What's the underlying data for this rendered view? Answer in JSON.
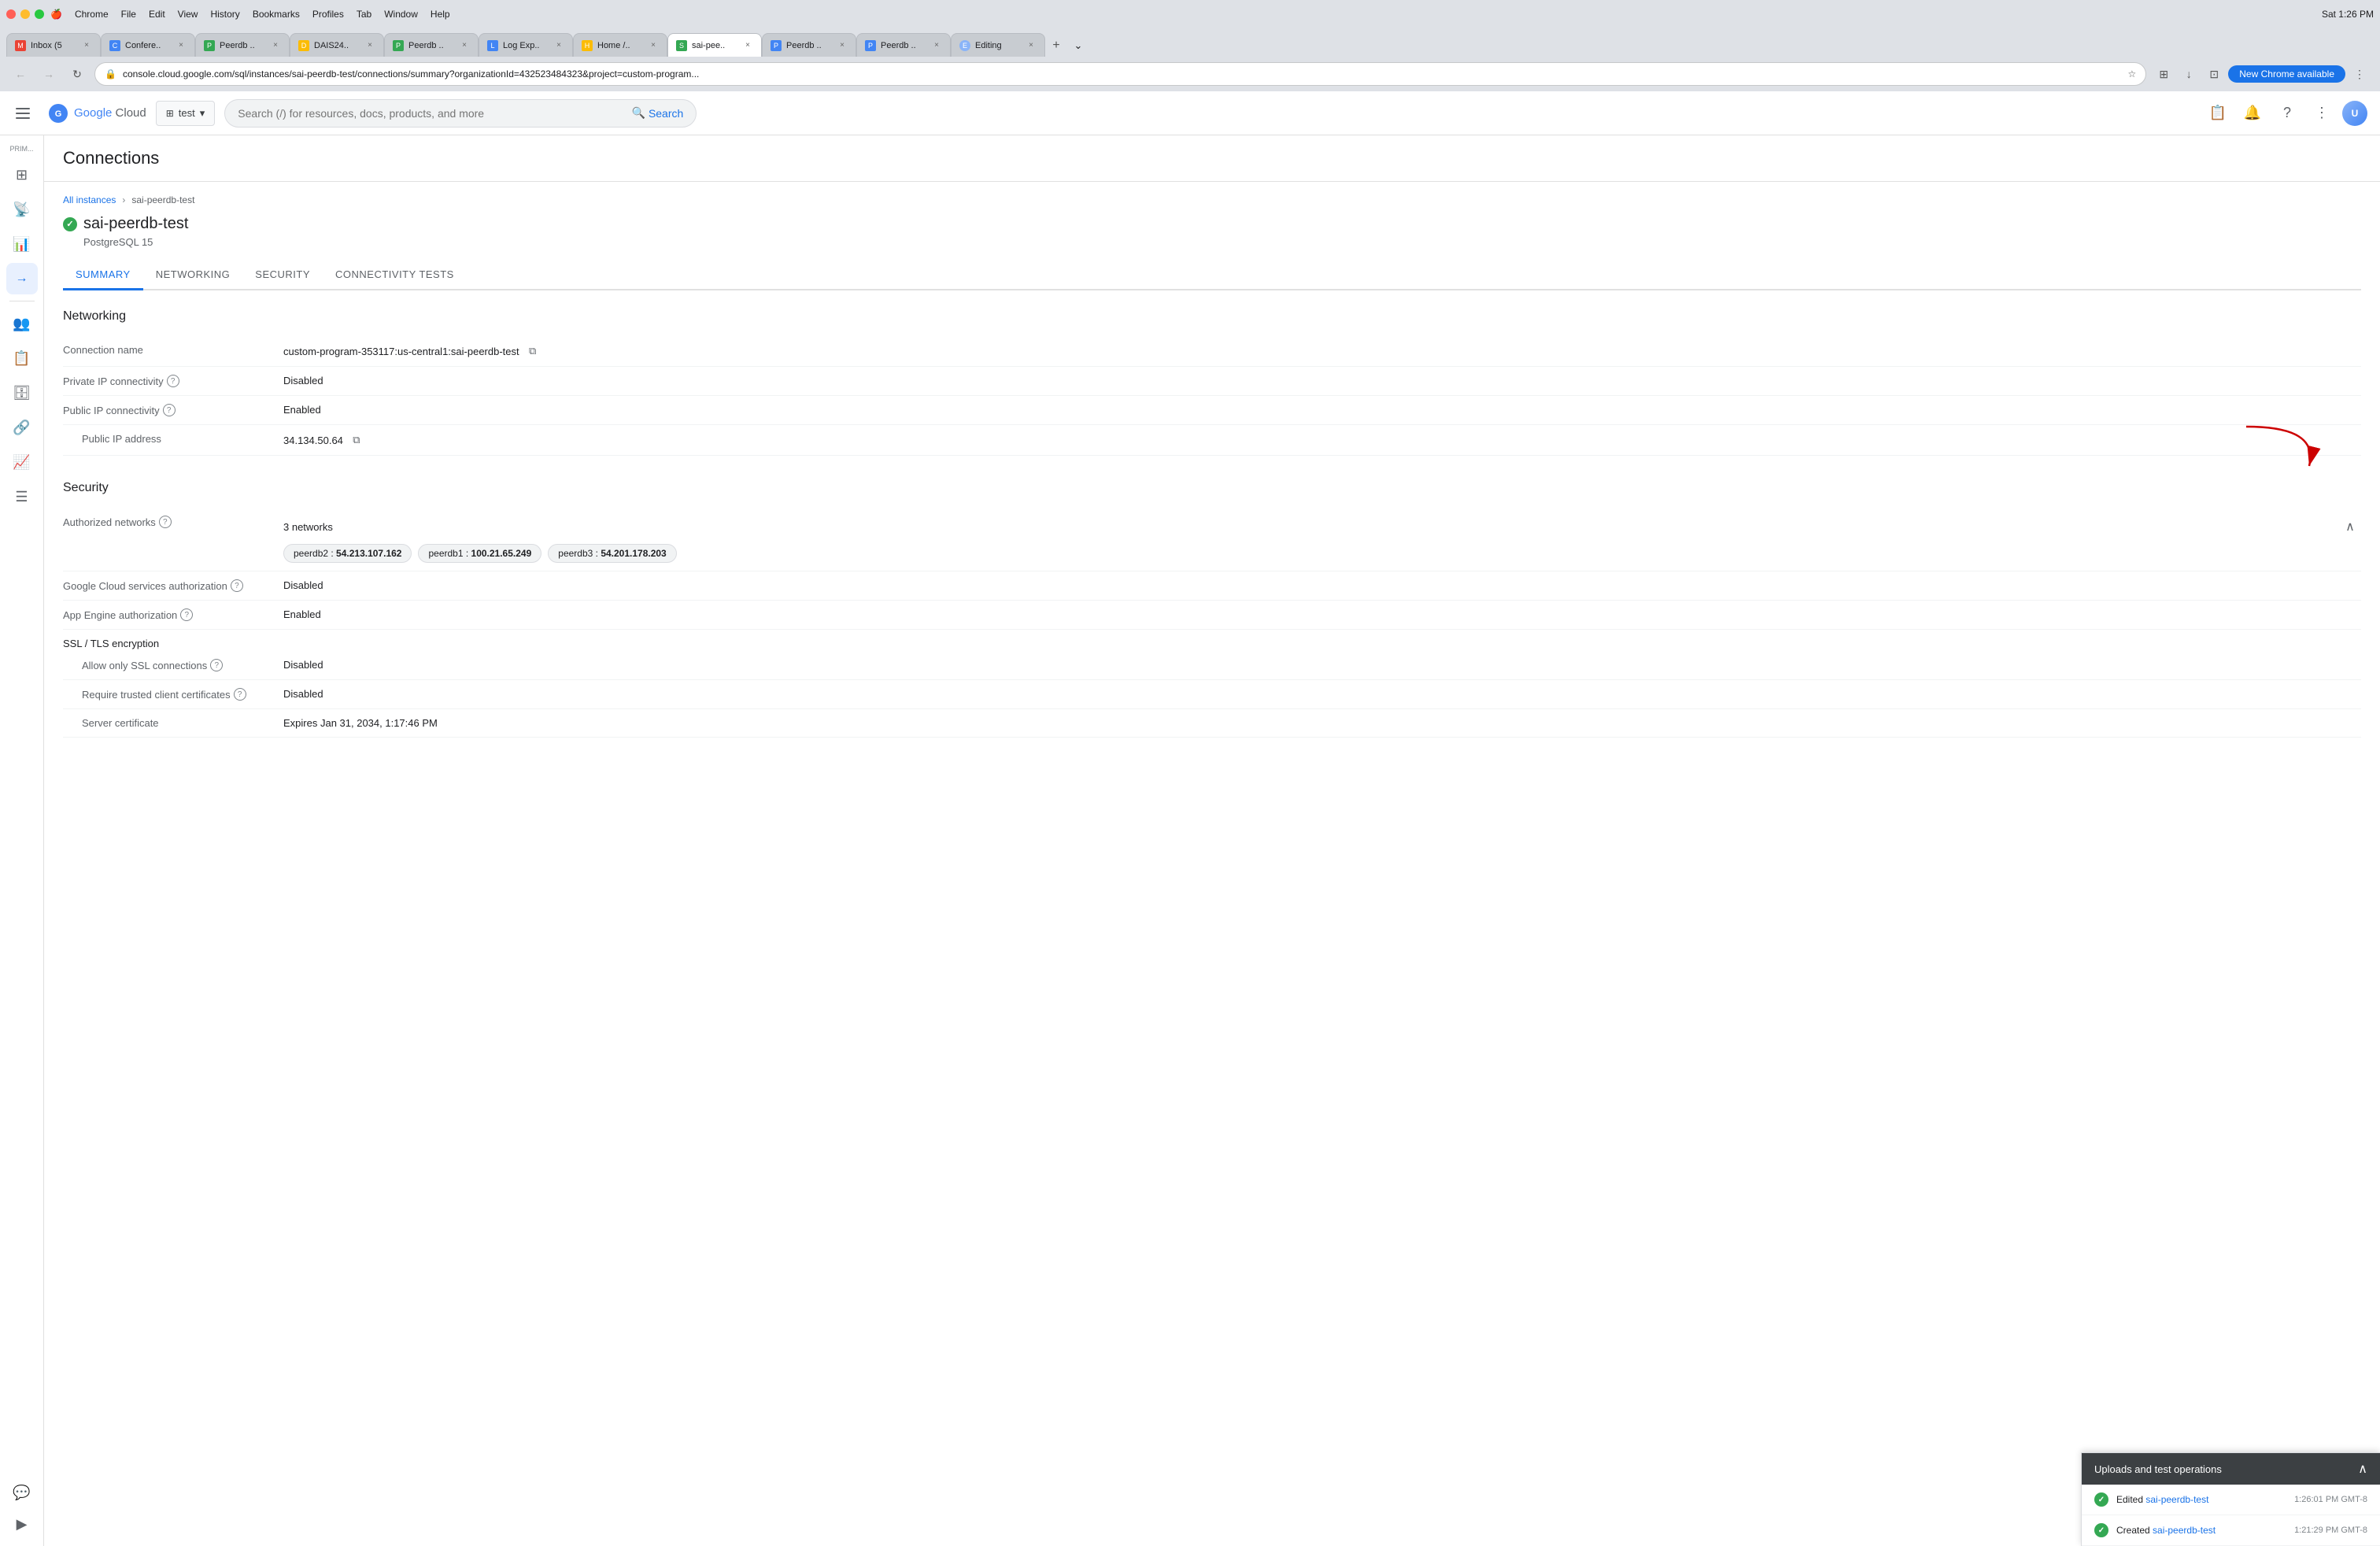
{
  "browser": {
    "tabs": [
      {
        "id": "gmail",
        "title": "Inbox (5",
        "favicon_color": "#EA4335",
        "favicon_letter": "M",
        "active": false
      },
      {
        "id": "conf",
        "title": "Confere..",
        "favicon_color": "#4285F4",
        "favicon_letter": "C",
        "active": false
      },
      {
        "id": "peerdb1",
        "title": "Peerdb ..",
        "favicon_color": "#34A853",
        "favicon_letter": "P",
        "active": false
      },
      {
        "id": "dais",
        "title": "DAIS24..",
        "favicon_color": "#FBBC05",
        "favicon_letter": "D",
        "active": false
      },
      {
        "id": "peerdb2",
        "title": "Peerdb ..",
        "favicon_color": "#34A853",
        "favicon_letter": "P",
        "active": false
      },
      {
        "id": "logexp",
        "title": "Log Exp..",
        "favicon_color": "#4285F4",
        "favicon_letter": "L",
        "active": false
      },
      {
        "id": "home",
        "title": "Home /..",
        "favicon_color": "#FBBC05",
        "favicon_letter": "H",
        "active": false
      },
      {
        "id": "saipee",
        "title": "sai-pee..",
        "favicon_color": "#34A853",
        "favicon_letter": "S",
        "active": true
      },
      {
        "id": "peerdb3",
        "title": "Peerdb ..",
        "favicon_color": "#4285F4",
        "favicon_letter": "P",
        "active": false
      },
      {
        "id": "peerdb4",
        "title": "Peerdb ..",
        "favicon_color": "#4285F4",
        "favicon_letter": "P",
        "active": false
      },
      {
        "id": "editing",
        "title": "Editing",
        "favicon_color": "#8AB4F8",
        "favicon_letter": "E",
        "active": false
      }
    ],
    "url": "console.cloud.google.com/sql/instances/sai-peerdb-test/connections/summary?organizationId=432523484323&project=custom-program...",
    "chrome_update_label": "New Chrome available",
    "menu_items": [
      "Chrome",
      "File",
      "Edit",
      "View",
      "History",
      "Bookmarks",
      "Profiles",
      "Tab",
      "Window",
      "Help"
    ],
    "time": "Sat 1:26 PM"
  },
  "topbar": {
    "logo_google": "Google",
    "logo_cloud": "Cloud",
    "project_name": "test",
    "search_placeholder": "Search (/) for resources, docs, products, and more",
    "search_label": "Search"
  },
  "sidebar": {
    "label": "PRIM...",
    "items": [
      {
        "icon": "☰",
        "label": "Menu"
      },
      {
        "icon": "⊞",
        "label": "Dashboard"
      },
      {
        "icon": "📡",
        "label": "Monitor"
      },
      {
        "icon": "📊",
        "label": "Analytics"
      },
      {
        "icon": "→",
        "label": "SQL",
        "active": true
      },
      {
        "icon": "👥",
        "label": "IAM"
      },
      {
        "icon": "📋",
        "label": "Logs"
      },
      {
        "icon": "🗄",
        "label": "Storage"
      },
      {
        "icon": "🔗",
        "label": "Network"
      },
      {
        "icon": "📈",
        "label": "Reports"
      },
      {
        "icon": "☰",
        "label": "More"
      }
    ]
  },
  "page": {
    "section_title": "Connections",
    "breadcrumb_all": "All instances",
    "breadcrumb_current": "sai-peerdb-test",
    "instance_name": "sai-peerdb-test",
    "instance_version": "PostgreSQL 15",
    "tabs": [
      "SUMMARY",
      "NETWORKING",
      "SECURITY",
      "CONNECTIVITY TESTS"
    ],
    "active_tab": "SUMMARY",
    "networking": {
      "section_title": "Networking",
      "fields": [
        {
          "label": "Connection name",
          "value": "custom-program-353117:us-central1:sai-peerdb-test",
          "has_copy": true,
          "has_help": false
        },
        {
          "label": "Private IP connectivity",
          "value": "Disabled",
          "has_copy": false,
          "has_help": true
        },
        {
          "label": "Public IP connectivity",
          "value": "Enabled",
          "has_copy": false,
          "has_help": true
        },
        {
          "label": "   Public IP address",
          "value": "34.134.50.64",
          "has_copy": true,
          "has_help": false
        }
      ]
    },
    "security": {
      "section_title": "Security",
      "authorized_networks_label": "Authorized networks",
      "authorized_networks_count": "3 networks",
      "networks": [
        {
          "name": "peerdb2",
          "ip": "54.213.107.162"
        },
        {
          "name": "peerdb1",
          "ip": "100.21.65.249"
        },
        {
          "name": "peerdb3",
          "ip": "54.201.178.203"
        }
      ],
      "fields": [
        {
          "label": "Google Cloud services authorization",
          "value": "Disabled",
          "has_help": true
        },
        {
          "label": "App Engine authorization",
          "value": "Enabled",
          "has_help": true
        },
        {
          "label": "SSL / TLS encryption",
          "value": "",
          "has_help": false,
          "is_header": true
        },
        {
          "label": "   Allow only SSL connections",
          "value": "Disabled",
          "has_help": true
        },
        {
          "label": "   Require trusted client certificates",
          "value": "Disabled",
          "has_help": true
        },
        {
          "label": "   Server certificate",
          "value": "Expires Jan 31, 2034, 1:17:46 PM",
          "has_help": false
        }
      ]
    }
  },
  "bottom_panel": {
    "title": "Uploads and test operations",
    "items": [
      {
        "action": "Edited",
        "resource": "sai-peerdb-test",
        "time": "1:26:01 PM GMT-8"
      },
      {
        "action": "Created",
        "resource": "sai-peerdb-test",
        "time": "1:21:29 PM GMT-8"
      }
    ]
  }
}
